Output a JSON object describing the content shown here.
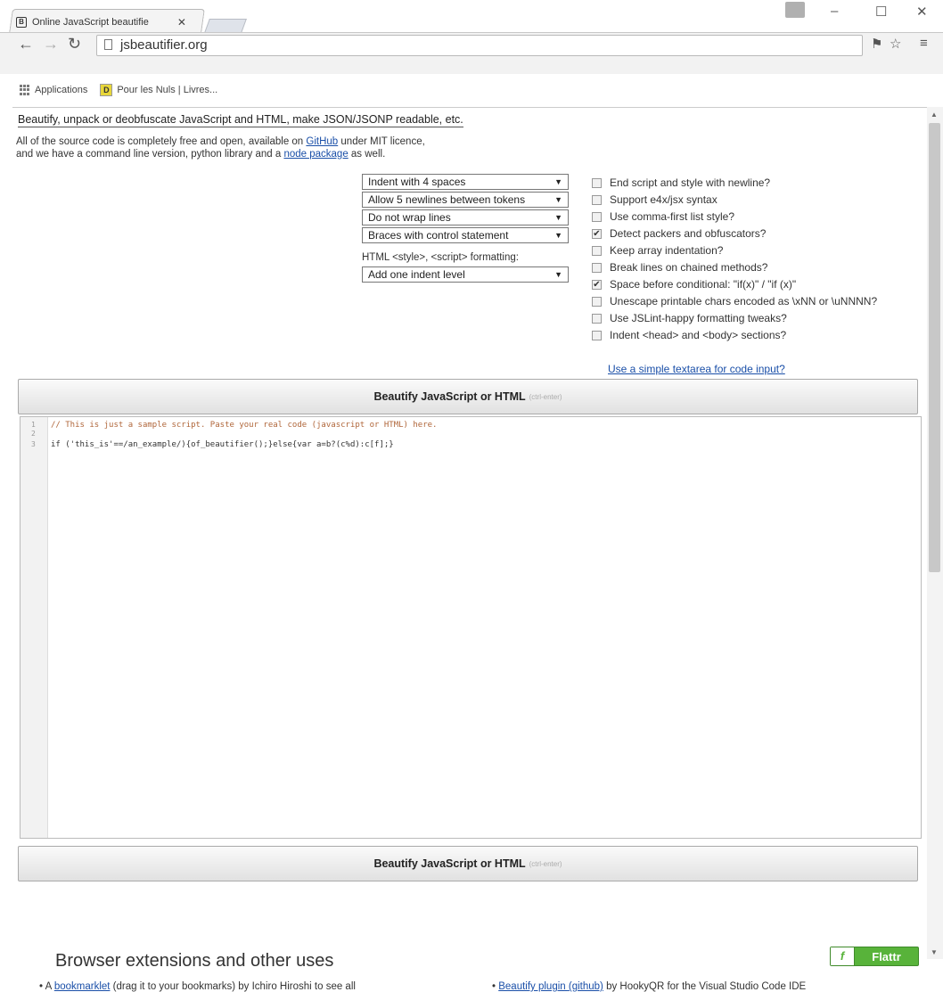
{
  "browser": {
    "tab_title": "Online JavaScript beautifie",
    "tab_close": "✕",
    "url": "jsbeautifier.org",
    "bookmarks": [
      "Applications",
      "Pour les Nuls | Livres..."
    ]
  },
  "page": {
    "headline": "Beautify, unpack or deobfuscate JavaScript and HTML, make JSON/JSONP readable, etc.",
    "intro_line1_pre": "All of the source code is completely free and open, available on ",
    "intro_line1_link": "GitHub",
    "intro_line1_post": " under MIT licence,",
    "intro_line2_pre": "and we have a command line version, python library and a ",
    "intro_line2_link": "node package",
    "intro_line2_post": " as well.",
    "selects": [
      "Indent with 4 spaces",
      "Allow 5 newlines between tokens",
      "Do not wrap lines",
      "Braces with control statement"
    ],
    "html_format_label": "HTML <style>, <script> formatting:",
    "html_format_select": "Add one indent level",
    "options": [
      {
        "label": "End script and style with newline?",
        "checked": false
      },
      {
        "label": "Support e4x/jsx syntax",
        "checked": false
      },
      {
        "label": "Use comma-first list style?",
        "checked": false
      },
      {
        "label": "Detect packers and obfuscators?",
        "checked": true
      },
      {
        "label": "Keep array indentation?",
        "checked": false
      },
      {
        "label": "Break lines on chained methods?",
        "checked": false
      },
      {
        "label": "Space before conditional: \"if(x)\" / \"if (x)\"",
        "checked": true
      },
      {
        "label": "Unescape printable chars encoded as \\xNN or \\uNNNN?",
        "checked": false
      },
      {
        "label": "Use JSLint-happy formatting tweaks?",
        "checked": false
      },
      {
        "label": "Indent <head> and <body> sections?",
        "checked": false
      }
    ],
    "textarea_link": "Use a simple textarea for code input?",
    "beautify_button": "Beautify JavaScript or HTML",
    "beautify_shortcut": "(ctrl-enter)",
    "editor": {
      "line_numbers": [
        "1",
        "2",
        "3"
      ],
      "line1": "// This is just a sample script. Paste your real code (javascript or HTML) here.",
      "line3": "if ('this_is'==/an_example/){of_beautifier();}else{var a=b?(c%d):c[f];}"
    },
    "extensions_title": "Browser extensions and other uses",
    "flattr_label": "Flattr",
    "bullet_left_pre": "A ",
    "bullet_left_link": "bookmarklet",
    "bullet_left_post": " (drag it to your bookmarks) by Ichiro Hiroshi to see all",
    "bullet_right_pre": "Beautify plugin ",
    "bullet_right_link": "(github)",
    "bullet_right_post": " by HookyQR for the Visual Studio Code IDE"
  },
  "colors": {
    "link": "#1a4fa8",
    "flattr": "#58b33a",
    "comment": "#b0663a"
  }
}
